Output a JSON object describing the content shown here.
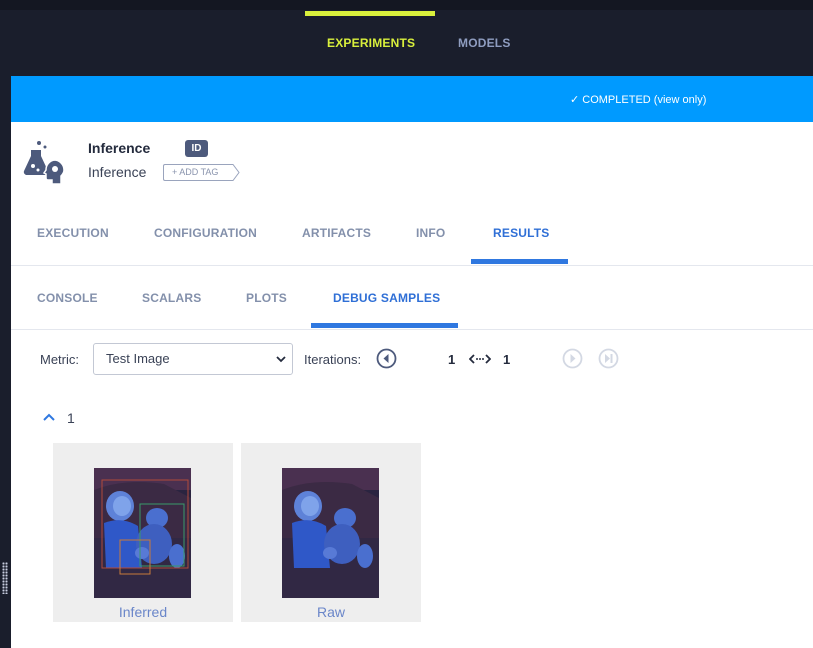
{
  "top_nav": {
    "tabs": [
      {
        "label": "EXPERIMENTS",
        "active": true
      },
      {
        "label": "MODELS",
        "active": false
      }
    ]
  },
  "status": {
    "text": "✓ COMPLETED (view only)"
  },
  "experiment": {
    "name": "Inference",
    "id_badge": "ID",
    "project": "Inference",
    "add_tag_label": "+ ADD TAG",
    "icon": "experiment-flask-brain-icon"
  },
  "main_tabs": [
    {
      "label": "EXECUTION",
      "active": false
    },
    {
      "label": "CONFIGURATION",
      "active": false
    },
    {
      "label": "ARTIFACTS",
      "active": false
    },
    {
      "label": "INFO",
      "active": false
    },
    {
      "label": "RESULTS",
      "active": true
    }
  ],
  "sub_tabs": [
    {
      "label": "CONSOLE",
      "active": false
    },
    {
      "label": "SCALARS",
      "active": false
    },
    {
      "label": "PLOTS",
      "active": false
    },
    {
      "label": "DEBUG SAMPLES",
      "active": true
    }
  ],
  "controls": {
    "metric_label": "Metric:",
    "metric_value": "Test Image",
    "iterations_label": "Iterations:",
    "iteration_from": "1",
    "iteration_to": "1"
  },
  "group": {
    "label": "1",
    "expanded": true
  },
  "samples": [
    {
      "caption": "Inferred",
      "has_boxes": true
    },
    {
      "caption": "Raw",
      "has_boxes": false
    }
  ],
  "colors": {
    "accent_lime": "#d9f03c",
    "status_blue": "#009aff",
    "tab_active": "#2f6fd6",
    "dark_bg": "#1a1e2c"
  }
}
